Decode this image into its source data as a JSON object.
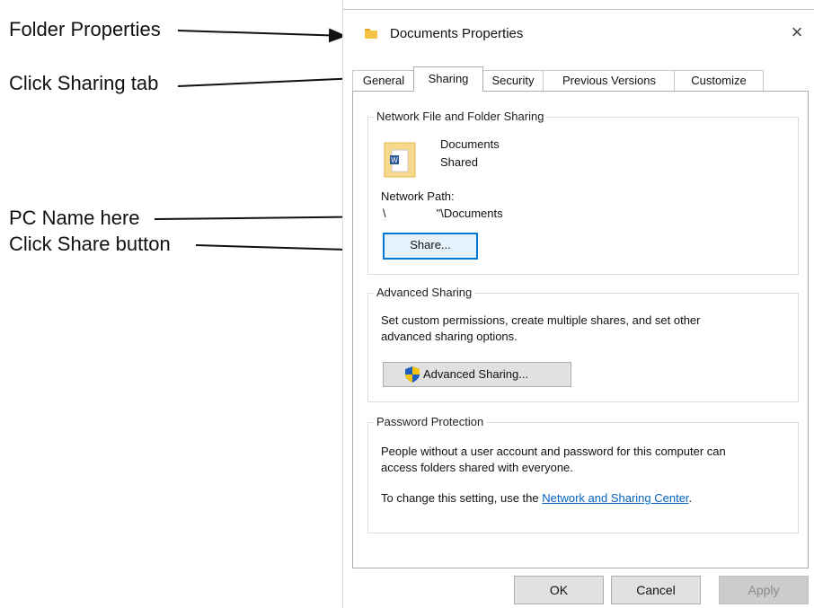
{
  "annotations": {
    "folder_properties": "Folder Properties",
    "click_sharing_tab": "Click Sharing tab",
    "pc_name_here": "PC Name here",
    "click_share_button": "Click Share button"
  },
  "dialog": {
    "title": "Documents Properties",
    "close_glyph": "×",
    "tabs": [
      {
        "label": "General"
      },
      {
        "label": "Sharing"
      },
      {
        "label": "Security"
      },
      {
        "label": "Previous Versions"
      },
      {
        "label": "Customize"
      }
    ],
    "active_tab": "Sharing",
    "network_sharing": {
      "group_title": "Network File and Folder Sharing",
      "folder_name": "Documents",
      "status": "Shared",
      "path_label": "Network Path:",
      "path_value_prefix": "\\",
      "path_value_suffix": "\"\\Documents",
      "share_button": "Share..."
    },
    "advanced_sharing": {
      "group_title": "Advanced Sharing",
      "description_line1": "Set custom permissions, create multiple shares, and set other",
      "description_line2": "advanced sharing options.",
      "button": "Advanced Sharing..."
    },
    "password_protection": {
      "group_title": "Password Protection",
      "description_line1": "People without a user account and password for this computer can",
      "description_line2": "access folders shared with everyone.",
      "change_text": "To change this setting, use the ",
      "link_text": "Network and Sharing Center",
      "period": "."
    },
    "buttons": {
      "ok": "OK",
      "cancel": "Cancel",
      "apply": "Apply"
    }
  },
  "colors": {
    "accent": "#0078d7",
    "link": "#0563c1",
    "folder": "#f6c344"
  }
}
